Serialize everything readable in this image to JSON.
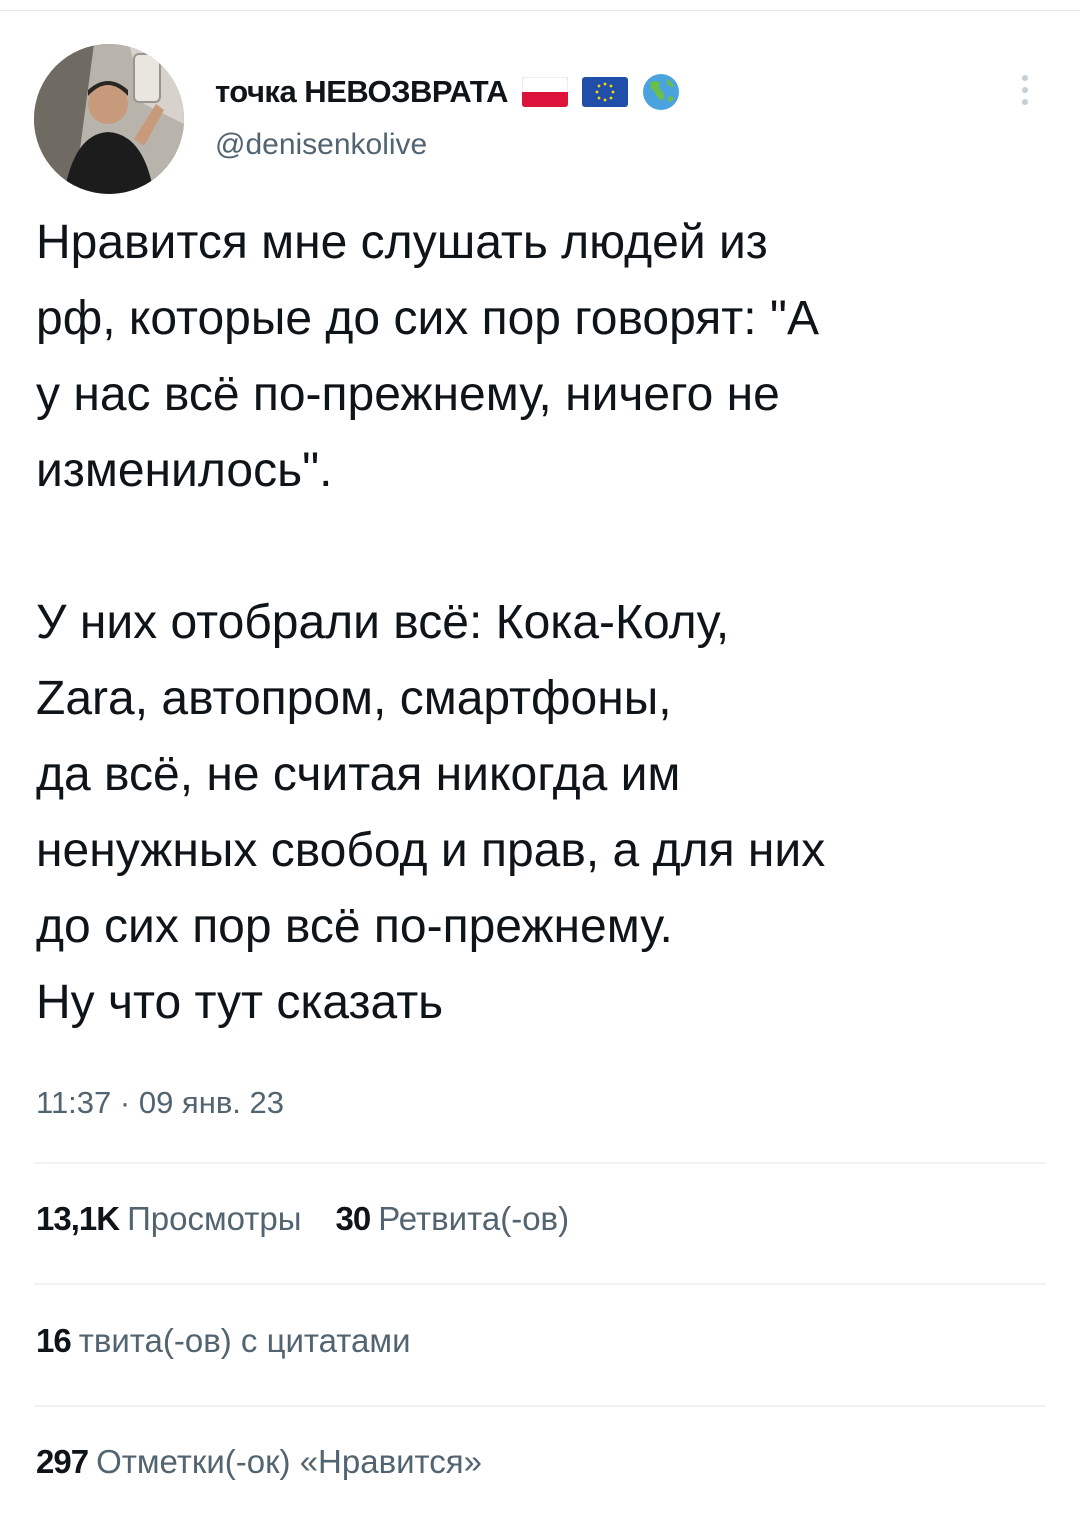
{
  "author": {
    "display_name": "точка НЕВОЗВРАТА",
    "handle": "@denisenkolive",
    "badges": [
      "poland-flag-icon",
      "eu-flag-icon",
      "globe-icon"
    ]
  },
  "tweet": {
    "paragraph1": "Нравится мне слушать людей из\nрф, которые до сих пор говорят: \"А\nу нас всё по-прежнему, ничего не\nизменилось\".",
    "paragraph2": "У них отобрали всё: Кока-Колу,\nZara, автопром, смартфоны,\nда всё, не считая никогда им\nненужных свобод и прав, а для них\nдо сих пор всё по-прежнему.\nНу что тут сказать",
    "timestamp": "11:37 · 09 янв. 23"
  },
  "stats": {
    "views_count": "13,1K",
    "views_label": "Просмотры",
    "retweets_count": "30",
    "retweets_label": "Ретвита(-ов)",
    "quotes_count": "16",
    "quotes_label": "твита(-ов) с цитатами",
    "likes_count": "297",
    "likes_label": "Отметки(-ок) «Нравится»"
  },
  "colors": {
    "text_primary": "#0f1419",
    "text_secondary": "#536471",
    "divider": "#eff3f4"
  }
}
